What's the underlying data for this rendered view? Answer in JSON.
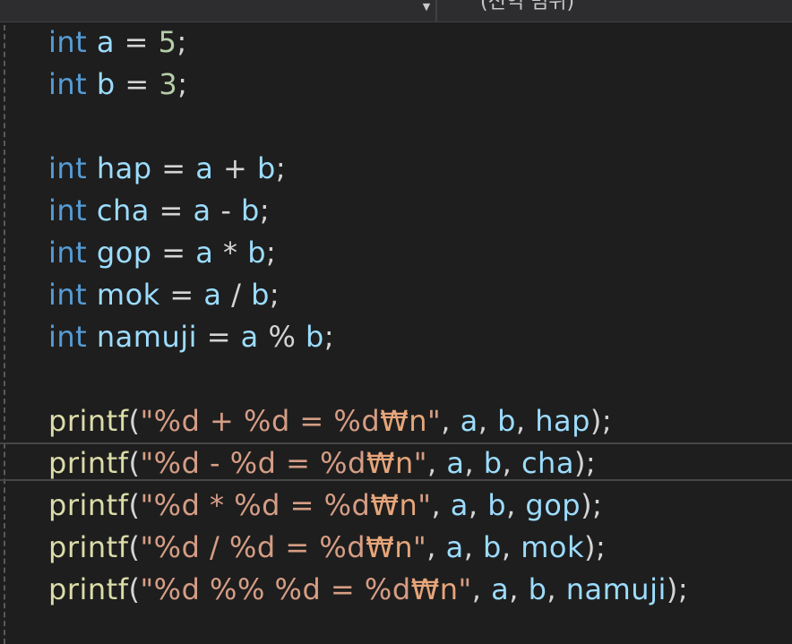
{
  "header": {
    "scope_label": "(전역 범위)",
    "dropdown_icon": "chevron-down-icon"
  },
  "colors": {
    "background": "#1e1e1e",
    "keyword": "#569cd6",
    "identifier": "#9cdcfe",
    "operator": "#d4d4d4",
    "number": "#b5cea8",
    "function": "#dcdcaa",
    "string": "#d69d85"
  },
  "code": {
    "l1": {
      "kw": "int",
      "a": " a",
      "op": " = ",
      "n": "5",
      "end": ";"
    },
    "l2": {
      "kw": "int",
      "a": " b",
      "op": " = ",
      "n": "3",
      "end": ";"
    },
    "l4": {
      "kw": "int",
      "v": " hap",
      "op": " = ",
      "x": "a",
      "o2": " + ",
      "y": "b",
      "end": ";"
    },
    "l5": {
      "kw": "int",
      "v": " cha",
      "op": " = ",
      "x": "a",
      "o2": " - ",
      "y": "b",
      "end": ";"
    },
    "l6": {
      "kw": "int",
      "v": " gop",
      "op": " = ",
      "x": "a",
      "o2": " * ",
      "y": "b",
      "end": ";"
    },
    "l7": {
      "kw": "int",
      "v": " mok",
      "op": " = ",
      "x": "a",
      "o2": " / ",
      "y": "b",
      "end": ";"
    },
    "l8": {
      "kw": "int",
      "v": " namuji",
      "op": " = ",
      "x": "a",
      "o2": " % ",
      "y": "b",
      "end": ";"
    },
    "p1": {
      "fn": "printf",
      "open": "(",
      "s": "\"%d + %d = %d",
      "esc": "₩n",
      "q": "\"",
      "c1": ", ",
      "a": "a",
      "c2": ", ",
      "b": "b",
      "c3": ", ",
      "r": "hap",
      "close": ");"
    },
    "p2": {
      "fn": "printf",
      "open": "(",
      "s": "\"%d - %d = %d",
      "esc": "₩n",
      "q": "\"",
      "c1": ", ",
      "a": "a",
      "c2": ", ",
      "b": "b",
      "c3": ", ",
      "r": "cha",
      "close": ");"
    },
    "p3": {
      "fn": "printf",
      "open": "(",
      "s": "\"%d * %d = %d",
      "esc": "₩n",
      "q": "\"",
      "c1": ", ",
      "a": "a",
      "c2": ", ",
      "b": "b",
      "c3": ", ",
      "r": "gop",
      "close": ");"
    },
    "p4": {
      "fn": "printf",
      "open": "(",
      "s": "\"%d / %d = %d",
      "esc": "₩n",
      "q": "\"",
      "c1": ", ",
      "a": "a",
      "c2": ", ",
      "b": "b",
      "c3": ", ",
      "r": "mok",
      "close": ");"
    },
    "p5": {
      "fn": "printf",
      "open": "(",
      "s": "\"%d %% %d = %d",
      "esc": "₩n",
      "q": "\"",
      "c1": ", ",
      "a": "a",
      "c2": ", ",
      "b": "b",
      "c3": ", ",
      "r": "namuji",
      "close": ");"
    }
  }
}
